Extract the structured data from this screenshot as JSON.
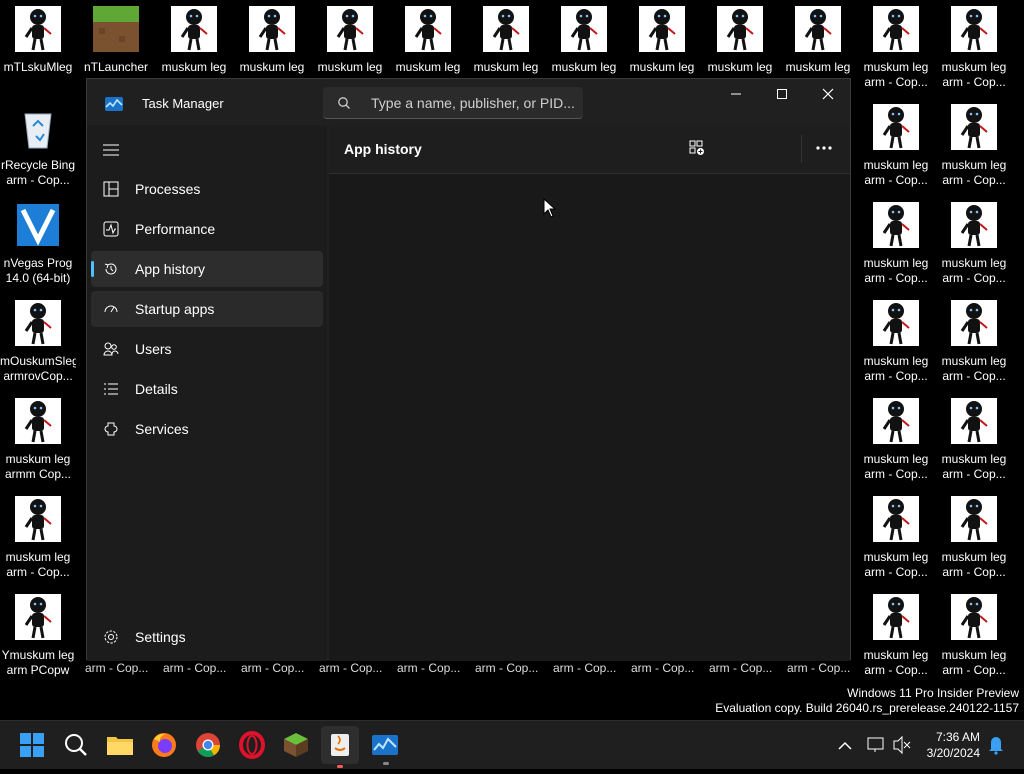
{
  "desktop": {
    "top_row": [
      "mTLskuMleg",
      "nTLauncher",
      "muskum leg",
      "muskum leg",
      "muskum leg",
      "muskum leg",
      "muskum leg",
      "muskum leg",
      "muskum leg",
      "muskum leg",
      "muskum leg",
      "muskum leg",
      "muskum leg"
    ],
    "top_row_sub": [
      "arm - Cop...",
      "arm - Cop..."
    ],
    "left_col": [
      {
        "l1": "rRecycle Bing",
        "l2": "arm - Cop..."
      },
      {
        "l1": "nVegas Prog",
        "l2": "14.0 (64-bit)"
      },
      {
        "l1": "mOuskumSleg",
        "l2": "armrovCop..."
      },
      {
        "l1": "muskum leg",
        "l2": "armm Cop..."
      },
      {
        "l1": "muskum leg",
        "l2": "arm - Cop..."
      },
      {
        "l1": "Ymuskum leg",
        "l2": "arm PCopw"
      }
    ],
    "right_cols": {
      "l1": "muskum leg",
      "l2": "arm - Cop..."
    },
    "bottom_row_label": "arm - Cop..."
  },
  "task_manager": {
    "title": "Task Manager",
    "search_placeholder": "Type a name, publisher, or PID...",
    "page_title": "App history",
    "nav": [
      {
        "label": "Processes",
        "icon": "processes-icon"
      },
      {
        "label": "Performance",
        "icon": "performance-icon"
      },
      {
        "label": "App history",
        "icon": "app-history-icon",
        "active": true
      },
      {
        "label": "Startup apps",
        "icon": "startup-apps-icon"
      },
      {
        "label": "Users",
        "icon": "users-icon"
      },
      {
        "label": "Details",
        "icon": "details-icon"
      },
      {
        "label": "Services",
        "icon": "services-icon"
      }
    ],
    "settings_label": "Settings"
  },
  "watermark": {
    "line1": "Windows 11 Pro Insider Preview",
    "line2": "Evaluation copy. Build 26040.rs_prerelease.240122-1157"
  },
  "taskbar": {
    "time": "7:36 AM",
    "date": "3/20/2024"
  },
  "colors": {
    "accent": "#4cc2ff",
    "window_bg": "#202020",
    "nav_bg": "#1c1c1c"
  }
}
